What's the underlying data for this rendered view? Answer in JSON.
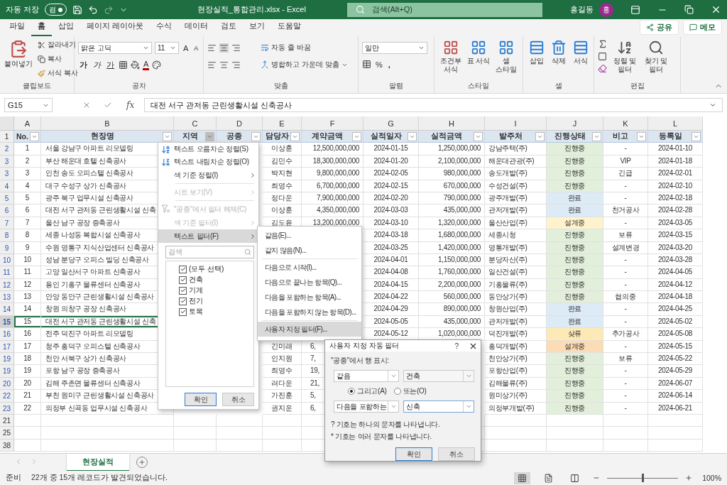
{
  "title_bar": {
    "autosave_label": "자동 저장",
    "autosave": {
      "text": "켬",
      "on": true
    },
    "title": "현장실적_통합관리.xlsx - Excel",
    "search_placeholder": "검색(Alt+Q)",
    "user": "홍길동",
    "avatar": "홍"
  },
  "menu_tabs": [
    {
      "label": "파일",
      "selected": false
    },
    {
      "label": "홈",
      "selected": true
    },
    {
      "label": "삽입",
      "selected": false
    },
    {
      "label": "페이지 레이아웃",
      "selected": false
    },
    {
      "label": "수식",
      "selected": false
    },
    {
      "label": "데이터",
      "selected": false
    },
    {
      "label": "검토",
      "selected": false
    },
    {
      "label": "보기",
      "selected": false
    },
    {
      "label": "도움말",
      "selected": false
    }
  ],
  "share_button": "공유",
  "comments_button": "메모",
  "ribbon": {
    "clipboard": {
      "paste": "붙여넣기",
      "cut": "잘라내기",
      "copy": "복사",
      "format_painter": "서식 복사",
      "label": "클립보드"
    },
    "font": {
      "name": "맑은 고딕",
      "size": "11",
      "grow": "A",
      "shrink": "A",
      "bold": "가",
      "italic": "가",
      "underline": "가",
      "color_letter": "A",
      "label": "공차"
    },
    "alignment": {
      "wrap": "자동 줄 바꿈",
      "merge": "병합하고 가운데 맞춤",
      "label": "맞춤"
    },
    "number": {
      "format": "일만",
      "percent": "%",
      "comma": ",",
      "label": "팔렴"
    },
    "styles": {
      "items": [
        "조건부 서식",
        "표 서식",
        "셀 스타일"
      ],
      "label": "스타일"
    },
    "cells": {
      "items": [
        "삽입",
        "삭제",
        "서식"
      ],
      "label": "셀"
    },
    "editing": {
      "items": [
        "정렬 및 필터",
        "찾기 및 필터"
      ],
      "label": "편집"
    }
  },
  "formula_bar": {
    "name_box": "G15",
    "fx": "fx",
    "content": "대전 서구 관저동 근린생활시설 신축공사"
  },
  "column_letters": [
    "A",
    "B",
    "C",
    "D",
    "E",
    "F",
    "G",
    "H",
    "I",
    "J",
    "K",
    "L"
  ],
  "header_row": {
    "label": "1",
    "cells": [
      {
        "text": "No.",
        "open": false
      },
      {
        "text": "현장명",
        "open": false
      },
      {
        "text": "지역",
        "open": true
      },
      {
        "text": "공종",
        "open": false
      },
      {
        "text": "담당자",
        "open": false
      },
      {
        "text": "계약금액",
        "open": false
      },
      {
        "text": "실적일자",
        "open": false
      },
      {
        "text": "실적금액",
        "open": false
      },
      {
        "text": "발주처",
        "open": false
      },
      {
        "text": "진행상태",
        "open": false
      },
      {
        "text": "비고",
        "open": false
      },
      {
        "text": "등록일",
        "open": false
      }
    ]
  },
  "rows": [
    {
      "label": "2",
      "filtered": true,
      "selected": false,
      "cells": [
        "1",
        "서울 강남구 아파트 리모델링",
        null,
        null,
        "이상훈",
        "12,500,000,000",
        "2024-01-15",
        "1,250,000,000",
        "강남주택(주)",
        {
          "text": "진행중",
          "color": "#e2efda"
        },
        "-",
        "2024-01-10"
      ]
    },
    {
      "label": "3",
      "filtered": true,
      "selected": false,
      "cells": [
        "2",
        "부산 해운대 호텔 신축공사",
        null,
        null,
        "김민수",
        "18,300,000,000",
        "2024-01-20",
        "2,100,000,000",
        "해운대관광(주)",
        {
          "text": "진행중",
          "color": "#e2efda"
        },
        "VIP",
        "2024-01-18"
      ]
    },
    {
      "label": "3",
      "filtered": true,
      "selected": false,
      "cells": [
        "3",
        "인천 송도 오피스텔 신축공사",
        null,
        null,
        "박지현",
        "9,800,000,000",
        "2024-02-05",
        "980,000,000",
        "송도개발(주)",
        {
          "text": "진행중",
          "color": "#e2efda"
        },
        "긴급",
        "2024-02-01"
      ]
    },
    {
      "label": "4",
      "filtered": true,
      "selected": false,
      "cells": [
        "4",
        "대구 수성구 상가 신축공사",
        null,
        null,
        "최영수",
        "6,700,000,000",
        "2024-02-15",
        "670,000,000",
        "수성건설(주)",
        {
          "text": "진행중",
          "color": "#e2efda"
        },
        "-",
        "2024-02-10"
      ]
    },
    {
      "label": "5",
      "filtered": true,
      "selected": false,
      "cells": [
        "5",
        "광주 북구 업무시설 신축공사",
        null,
        null,
        "정다운",
        "7,900,000,000",
        "2024-02-20",
        "790,000,000",
        "광주개발(주)",
        {
          "text": "완료",
          "color": "#ddebf7"
        },
        "-",
        "2024-02-18"
      ]
    },
    {
      "label": "6",
      "filtered": true,
      "selected": false,
      "cells": [
        "6",
        "대전 서구 관저동 근린생활시설 신축",
        null,
        null,
        "이상훈",
        "4,350,000,000",
        "2024-03-03",
        "435,000,000",
        "관저개발(주)",
        {
          "text": "완료",
          "color": "#ddebf7"
        },
        "천거공사",
        "2024-02-28"
      ]
    },
    {
      "label": "7",
      "filtered": true,
      "selected": false,
      "cells": [
        "7",
        "울산 남구 공장 증축공사",
        null,
        null,
        "김도윤",
        "13,200,000,000",
        "2024-03-10",
        "1,320,000,000",
        "울산산업(주)",
        {
          "text": "설계중",
          "color": "#fff2cc"
        },
        "-",
        "2024-03-05"
      ]
    },
    {
      "label": "8",
      "filtered": true,
      "selected": false,
      "cells": [
        "8",
        "세종 나성동 복합시설 신축공사",
        null,
        null,
        null,
        null,
        "2024-03-18",
        "1,680,000,000",
        "세종시청",
        {
          "text": "진행중",
          "color": "#e2efda"
        },
        "보류",
        "2024-03-15"
      ]
    },
    {
      "label": "9",
      "filtered": true,
      "selected": false,
      "cells": [
        "9",
        "수원 영통구 지식산업센터 신축공사",
        null,
        null,
        null,
        null,
        "2024-03-25",
        "1,420,000,000",
        "영통개발(주)",
        {
          "text": "진행중",
          "color": "#e2efda"
        },
        "설계변경",
        "2024-03-20"
      ]
    },
    {
      "label": "10",
      "filtered": true,
      "selected": false,
      "cells": [
        "10",
        "성남 분당구 오피스 빌딩 신축공사",
        null,
        null,
        null,
        null,
        "2024-04-01",
        "1,150,000,000",
        "분당자산(주)",
        {
          "text": "진행중",
          "color": "#e2efda"
        },
        "-",
        "2024-03-28"
      ]
    },
    {
      "label": "11",
      "filtered": true,
      "selected": false,
      "cells": [
        "11",
        "고양 일산서구 아파트 신축공사",
        null,
        null,
        null,
        null,
        "2024-04-08",
        "1,760,000,000",
        "일산건설(주)",
        {
          "text": "진행중",
          "color": "#e2efda"
        },
        "-",
        "2024-04-05"
      ]
    },
    {
      "label": "12",
      "filtered": true,
      "selected": false,
      "cells": [
        "12",
        "용인 기흥구 물류센터 신축공사",
        null,
        null,
        null,
        null,
        "2024-04-15",
        "2,200,000,000",
        "기흥물류(주)",
        {
          "text": "진행중",
          "color": "#e2efda"
        },
        "-",
        "2024-04-12"
      ]
    },
    {
      "label": "13",
      "filtered": true,
      "selected": false,
      "cells": [
        "13",
        "안양 동안구 근린생활시설 신축공사",
        null,
        null,
        null,
        null,
        "2024-04-22",
        "560,000,000",
        "동안상가(주)",
        {
          "text": "진행중",
          "color": "#e2efda"
        },
        "협의중",
        "2024-04-18"
      ]
    },
    {
      "label": "14",
      "filtered": true,
      "selected": false,
      "cells": [
        "14",
        "창원 의창구 공장 신축공사",
        null,
        null,
        null,
        null,
        "2024-04-29",
        "890,000,000",
        "창원산업(주)",
        {
          "text": "완료",
          "color": "#ddebf7"
        },
        "-",
        "2024-04-25"
      ]
    },
    {
      "label": "15",
      "filtered": true,
      "selected": true,
      "cells": [
        "15",
        "대전 서구 관저동 근린생활시설 신축",
        null,
        null,
        null,
        null,
        "2024-05-05",
        "435,000,000",
        "관저개발(주)",
        {
          "text": "완료",
          "color": "#ddebf7"
        },
        "-",
        "2024-05-02"
      ]
    },
    {
      "label": "16",
      "filtered": true,
      "selected": false,
      "cells": [
        "16",
        "전주 덕진구 아파트 리모델링",
        null,
        null,
        null,
        null,
        "2024-05-12",
        "1,020,000,000",
        "덕진개발(주)",
        {
          "text": "샂류",
          "color": "#fde9b6"
        },
        "추가공사",
        "2024-05-08"
      ]
    },
    {
      "label": "17",
      "filtered": true,
      "selected": false,
      "cells": [
        "17",
        "청주 흥덕구 오피스텔 신축공사",
        null,
        null,
        "긴미래",
        {
          "text": "6,",
          "cut": true
        },
        null,
        null,
        "흥덕개발(주)",
        {
          "text": "설계중",
          "color": "#fbdcb4"
        },
        "-",
        "2024-05-15"
      ]
    },
    {
      "label": "19",
      "filtered": true,
      "selected": false,
      "cells": [
        "18",
        "천안 서북구 상가 신축공사",
        null,
        null,
        "인지원",
        {
          "text": "7,",
          "cut": true
        },
        null,
        null,
        "천안상가(주)",
        {
          "text": "진행중",
          "color": "#e2efda"
        },
        "보류",
        "2024-05-22"
      ]
    },
    {
      "label": "19",
      "filtered": true,
      "selected": false,
      "cells": [
        "19",
        "포항 남구 공장 증축공사",
        null,
        null,
        "최영수",
        {
          "text": "19,",
          "cut": true
        },
        null,
        null,
        "포항산업(주)",
        {
          "text": "진행중",
          "color": "#e2efda"
        },
        "-",
        "2024-05-29"
      ]
    },
    {
      "label": "20",
      "filtered": true,
      "selected": false,
      "cells": [
        "20",
        "김해 주촌면 물류센터 신축공사",
        null,
        null,
        "려다운",
        {
          "text": "21,",
          "cut": true
        },
        null,
        null,
        "김해물류(주)",
        {
          "text": "진행중",
          "color": "#e2efda"
        },
        "-",
        "2024-06-07"
      ]
    },
    {
      "label": "22",
      "filtered": true,
      "selected": false,
      "cells": [
        "21",
        "부천 원미구 근린생활시설 신축공사",
        null,
        null,
        "가진훈",
        {
          "text": "5,",
          "cut": true
        },
        null,
        null,
        "원미상가(주)",
        {
          "text": "진행중",
          "color": "#e2efda"
        },
        "-",
        "2024-06-14"
      ]
    },
    {
      "label": "23",
      "filtered": true,
      "selected": false,
      "cells": [
        "22",
        "의정부 신곡동 업무시설 신축공사",
        null,
        null,
        "권지운",
        {
          "text": "6,",
          "cut": true
        },
        null,
        null,
        "의정부개발(주)",
        {
          "text": "진행중",
          "color": "#e2efda"
        },
        "-",
        "2024-06-21"
      ]
    },
    {
      "label": "21",
      "filtered": false,
      "selected": false,
      "cells": []
    },
    {
      "label": "25",
      "filtered": false,
      "selected": false,
      "cells": []
    },
    {
      "label": "38",
      "filtered": false,
      "selected": false,
      "cells": []
    }
  ],
  "filter_menu": {
    "items": [
      {
        "kind": "sort_up",
        "label": "텍스트 오름차순 정렬(S)",
        "disabled": false,
        "submenu": false,
        "selected": false
      },
      {
        "kind": "sort_down",
        "label": "텍스트 내림차순 정렬(O)",
        "disabled": false,
        "submenu": false,
        "selected": false
      },
      {
        "kind": "item",
        "label": "색 기준 정렬(I)",
        "disabled": false,
        "submenu": true,
        "selected": false
      },
      {
        "kind": "item",
        "label": "시트 보기(V)",
        "disabled": true,
        "submenu": true,
        "selected": false
      },
      {
        "kind": "clear",
        "label": "\"공종\"에서 필터 해제(C)",
        "disabled": true,
        "submenu": false,
        "selected": false
      },
      {
        "kind": "item",
        "label": "색 기준 필터(I)",
        "disabled": true,
        "submenu": true,
        "selected": false
      },
      {
        "kind": "item",
        "label": "텍스트 필터(F)",
        "disabled": false,
        "submenu": true,
        "selected": true
      }
    ],
    "search_placeholder": "검색",
    "values": [
      {
        "label": "(모두 선택)",
        "checked": true
      },
      {
        "label": "건축",
        "checked": true
      },
      {
        "label": "기계",
        "checked": true
      },
      {
        "label": "전기",
        "checked": true
      },
      {
        "label": "토목",
        "checked": true
      }
    ],
    "buttons": [
      {
        "label": "확인",
        "default": true
      },
      {
        "label": "취소",
        "default": false
      }
    ]
  },
  "text_filter_menu": [
    {
      "label": "같음(E)...",
      "selected": false
    },
    {
      "label": "같지 않음(N)...",
      "selected": false
    },
    {
      "label": "다음으로 시작(I)...",
      "selected": false
    },
    {
      "label": "다음으로 끝나는 항목(Q)...",
      "selected": false
    },
    {
      "label": "다음을 포함하는 항목(A)...",
      "selected": false
    },
    {
      "label": "다음을 포함하지 않는 항목(D)...",
      "selected": false
    },
    {
      "label": "사용자 지정 필터(F)...",
      "selected": true
    }
  ],
  "dialog": {
    "title": "사용자 지정 자동 필터",
    "help": "?",
    "prompt": "\"공종\"에서 행 표시:",
    "conditions": [
      {
        "operator": "같음",
        "value": "건축"
      },
      {
        "operator": "다음을 포함하는",
        "value": "신축"
      }
    ],
    "joins": [
      {
        "label": "그리고(A)",
        "selected": true
      },
      {
        "label": "또는(O)",
        "selected": false
      }
    ],
    "notes": [
      "? 기호는 하나의 문자를 나타냅니다.",
      "* 기호는 여러 문자를 나타냅니다."
    ],
    "buttons": [
      {
        "label": "확인",
        "default": true
      },
      {
        "label": "취소",
        "default": false
      }
    ]
  },
  "sheet_tabs": [
    {
      "label": "현장실적",
      "selected": true
    }
  ],
  "status_bar": {
    "mode": "준비",
    "message": "22개 중 15개 레코드가 발견되었습니다.",
    "views": [
      {
        "selected": true
      },
      {
        "selected": false
      },
      {
        "selected": false
      }
    ],
    "zoom": {
      "level": 0.5,
      "reading": "100%"
    }
  }
}
